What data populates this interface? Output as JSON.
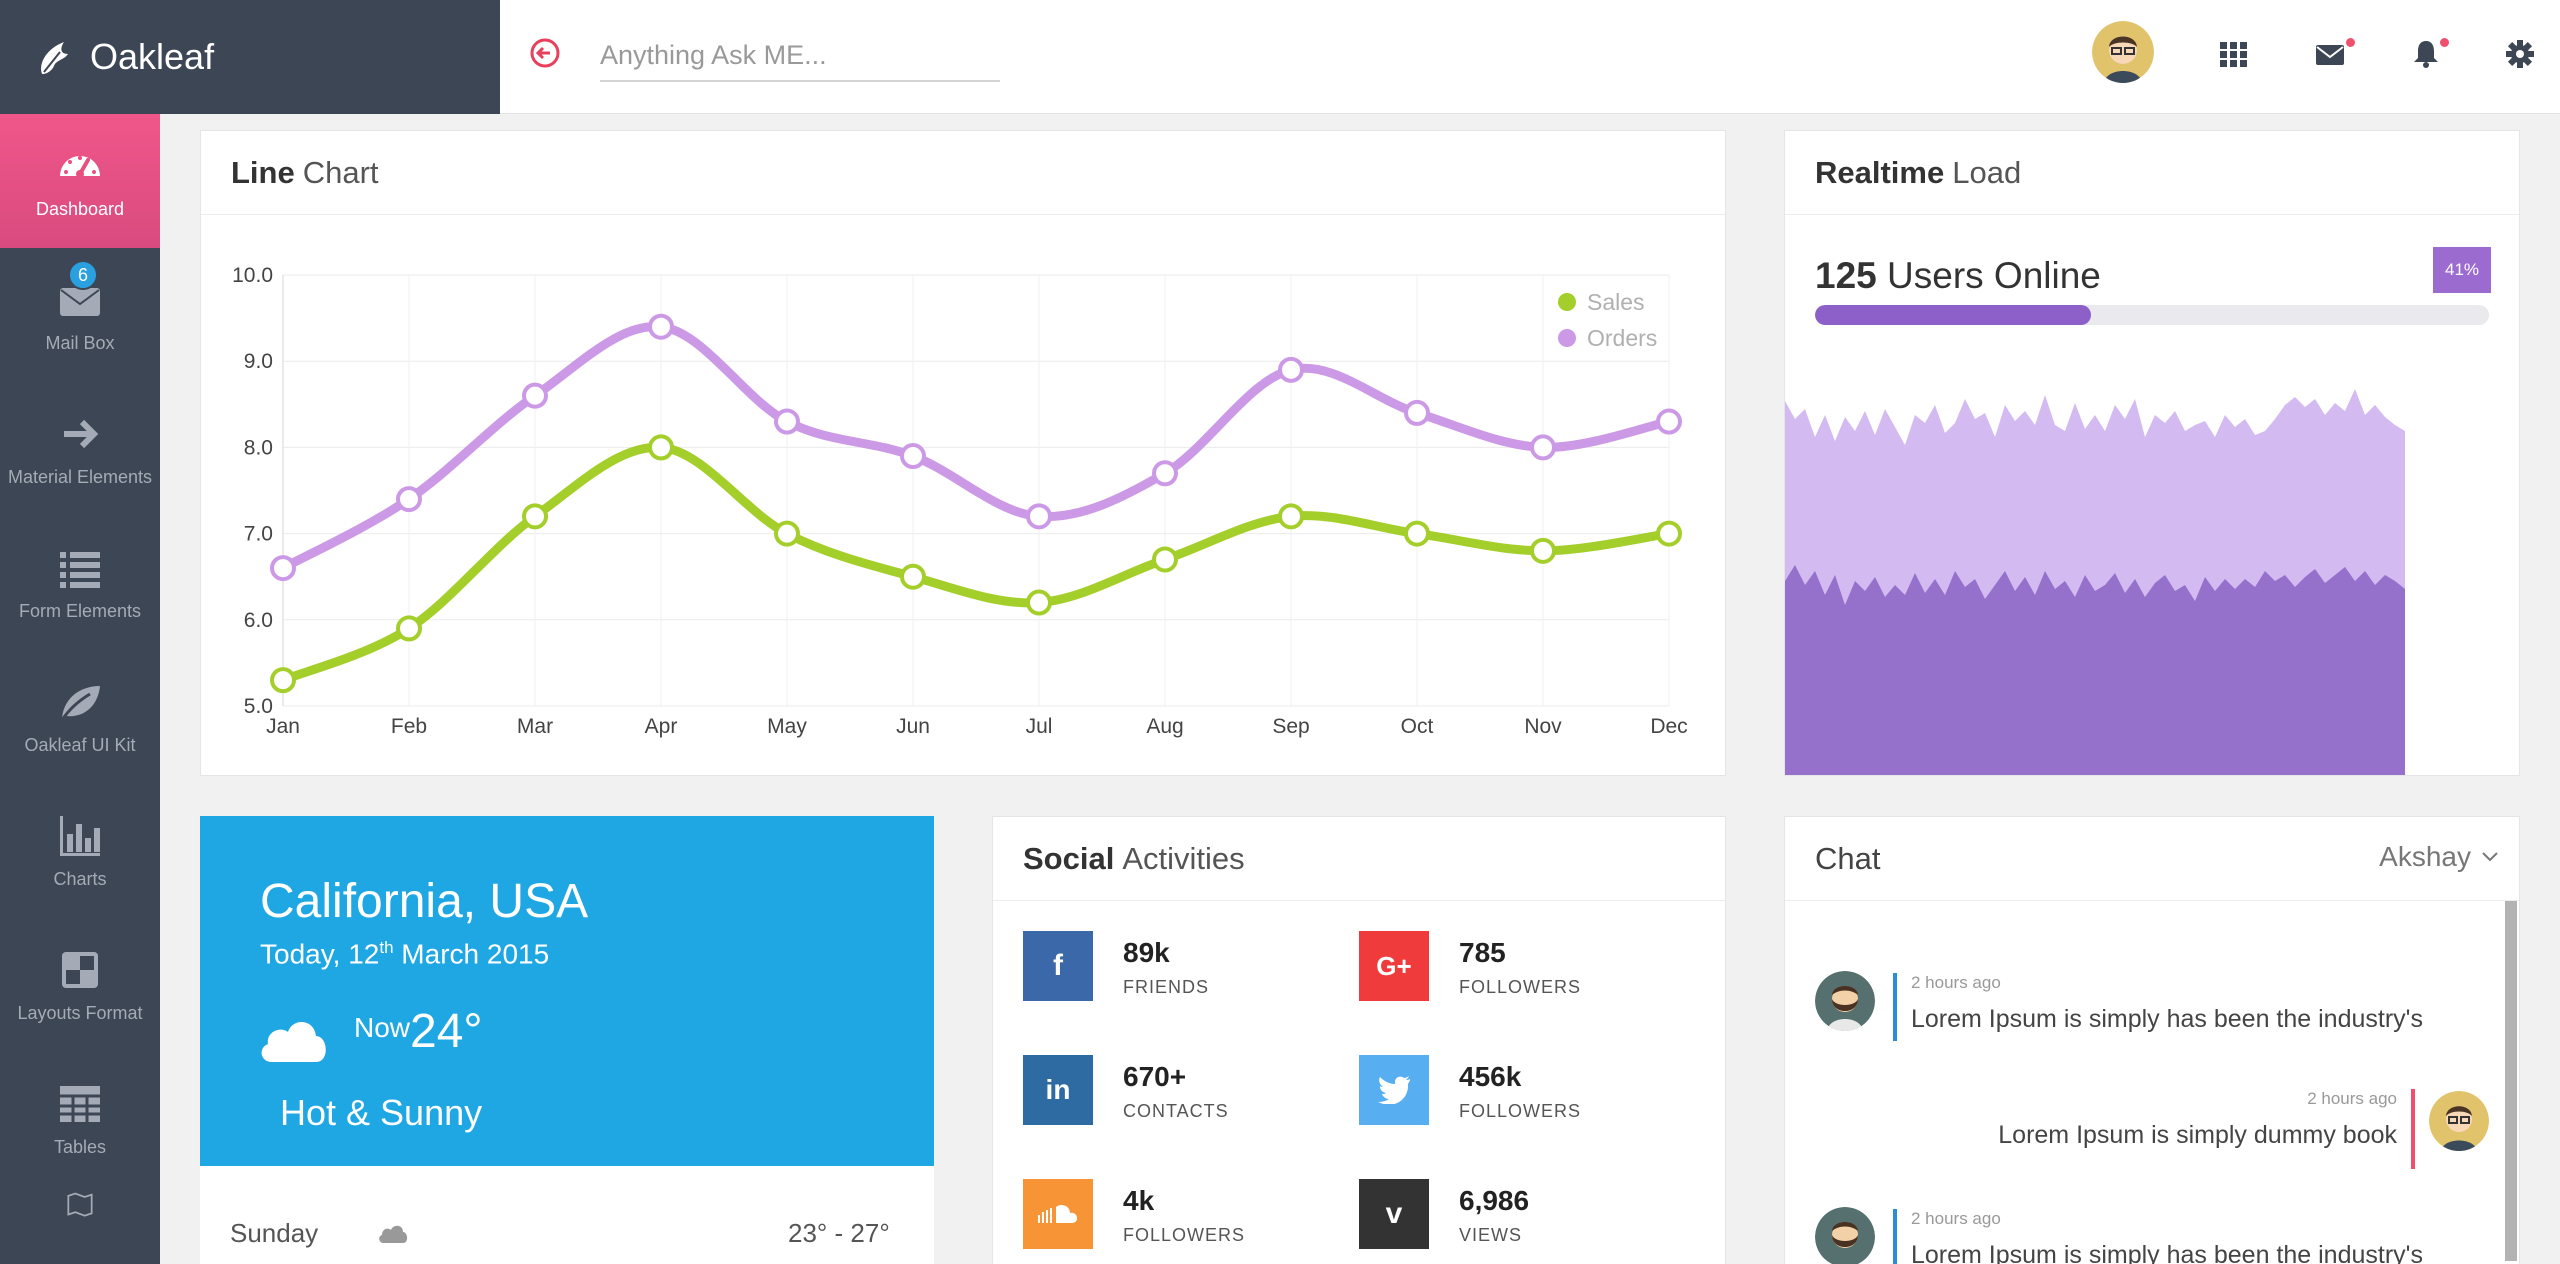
{
  "app": {
    "name": "Oakleaf"
  },
  "search": {
    "placeholder": "Anything Ask ME..."
  },
  "header_icons": [
    "user-avatar",
    "apps-grid-icon",
    "mail-icon",
    "bell-icon",
    "gear-icon"
  ],
  "sidebar": {
    "items": [
      {
        "label": "Dashboard",
        "icon": "dashboard-icon"
      },
      {
        "label": "Mail Box",
        "icon": "mail-icon",
        "badge": "6"
      },
      {
        "label": "Material Elements",
        "icon": "arrow-right-icon"
      },
      {
        "label": "Form Elements",
        "icon": "list-icon"
      },
      {
        "label": "Oakleaf UI Kit",
        "icon": "leaf-icon"
      },
      {
        "label": "Charts",
        "icon": "bar-chart-icon"
      },
      {
        "label": "Layouts Format",
        "icon": "layout-icon"
      },
      {
        "label": "Tables",
        "icon": "table-icon"
      }
    ]
  },
  "line_chart": {
    "title_bold": "Line",
    "title_rest": "Chart"
  },
  "chart_data": {
    "type": "line",
    "title": "Line Chart",
    "categories": [
      "Jan",
      "Feb",
      "Mar",
      "Apr",
      "May",
      "Jun",
      "Jul",
      "Aug",
      "Sep",
      "Oct",
      "Nov",
      "Dec"
    ],
    "series": [
      {
        "name": "Sales",
        "color": "#a4cf2a",
        "values": [
          5.3,
          5.9,
          7.2,
          8.0,
          7.0,
          6.5,
          6.2,
          6.7,
          7.2,
          7.0,
          6.8,
          7.0
        ]
      },
      {
        "name": "Orders",
        "color": "#cc99e6",
        "values": [
          6.6,
          7.4,
          8.6,
          9.4,
          8.3,
          7.9,
          7.2,
          7.7,
          8.9,
          8.4,
          8.0,
          8.3
        ]
      }
    ],
    "ylim": [
      5.0,
      10.0
    ],
    "yticks": [
      "5.0",
      "6.0",
      "7.0",
      "8.0",
      "9.0",
      "10.0"
    ],
    "grid": true,
    "legend": "top-right"
  },
  "realtime": {
    "title_bold": "Realtime",
    "title_rest": "Load",
    "users_count": "125",
    "users_label": "Users Online",
    "badge": "41%",
    "progress": 0.41
  },
  "weather": {
    "location": "California, USA",
    "date_prefix": "Today, 12",
    "date_sup": "th",
    "date_suffix": " March 2015",
    "now_label": "Now",
    "temp": "24°",
    "description": "Hot & Sunny",
    "forecast_day": "Sunday",
    "forecast_range": "23° - 27°"
  },
  "social": {
    "title_bold": "Social",
    "title_rest": "Activities",
    "items": [
      {
        "network": "facebook",
        "glyph": "f",
        "color": "#3b68a8",
        "value": "89k",
        "label": "FRIENDS"
      },
      {
        "network": "google-plus",
        "glyph": "G+",
        "color": "#ef3b3b",
        "value": "785",
        "label": "FOLLOWERS"
      },
      {
        "network": "linkedin",
        "glyph": "in",
        "color": "#2f6ba3",
        "value": "670+",
        "label": "CONTACTS"
      },
      {
        "network": "twitter",
        "glyph": "t",
        "color": "#57aef0",
        "value": "456k",
        "label": "FOLLOWERS"
      },
      {
        "network": "soundcloud",
        "glyph": "sc",
        "color": "#f79436",
        "value": "4k",
        "label": "FOLLOWERS"
      },
      {
        "network": "vimeo",
        "glyph": "v",
        "color": "#333333",
        "value": "6,986",
        "label": "VIEWS"
      }
    ]
  },
  "chat": {
    "title": "Chat",
    "user": "Akshay",
    "messages": [
      {
        "time": "2 hours ago",
        "text": "Lorem Ipsum is simply has been the industry's",
        "side": "left"
      },
      {
        "time": "2 hours ago",
        "text": "Lorem Ipsum is simply dummy book",
        "side": "right"
      },
      {
        "time": "2 hours ago",
        "text": "Lorem Ipsum is simply has been the industry's",
        "side": "left"
      }
    ]
  }
}
